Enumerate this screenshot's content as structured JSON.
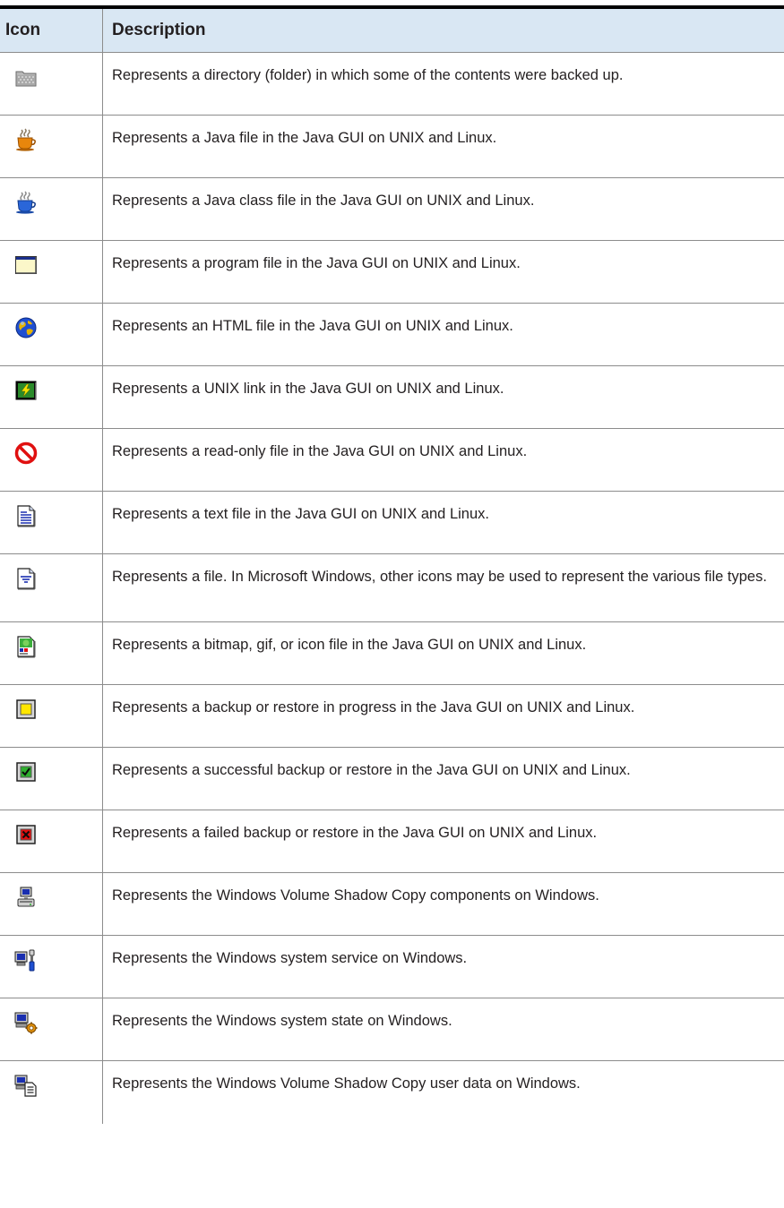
{
  "table": {
    "header": {
      "icon": "Icon",
      "description": "Description"
    },
    "rows": [
      {
        "icon": "partial-folder-icon",
        "description": "Represents a directory (folder) in which some of the contents were backed up."
      },
      {
        "icon": "java-file-icon",
        "description": "Represents a Java file in the Java GUI on UNIX and Linux."
      },
      {
        "icon": "java-class-file-icon",
        "description": "Represents a Java class file in the Java GUI on UNIX and Linux."
      },
      {
        "icon": "program-file-icon",
        "description": "Represents a program file in the Java GUI on UNIX and Linux."
      },
      {
        "icon": "html-file-globe-icon",
        "description": "Represents an HTML file in the Java GUI on UNIX and Linux."
      },
      {
        "icon": "unix-link-icon",
        "description": "Represents a UNIX link in the Java GUI on UNIX and Linux."
      },
      {
        "icon": "read-only-file-icon",
        "description": "Represents a read-only file in the Java GUI on UNIX and Linux."
      },
      {
        "icon": "text-file-icon",
        "description": "Represents a text file in the Java GUI on UNIX and Linux."
      },
      {
        "icon": "generic-file-icon",
        "description": "Represents a file. In Microsoft Windows, other icons may be used to represent the various file types."
      },
      {
        "icon": "image-file-icon",
        "description": "Represents a bitmap, gif, or icon file in the Java GUI on UNIX and Linux."
      },
      {
        "icon": "in-progress-icon",
        "description": "Represents a backup or restore in progress in the Java GUI on UNIX and Linux."
      },
      {
        "icon": "success-icon",
        "description": "Represents a successful backup or restore in the Java GUI on UNIX and Linux."
      },
      {
        "icon": "failed-icon",
        "description": "Represents a failed backup or restore in the Java GUI on UNIX and Linux."
      },
      {
        "icon": "vss-components-icon",
        "description": "Represents the Windows Volume Shadow Copy components on Windows."
      },
      {
        "icon": "system-service-icon",
        "description": "Represents the Windows system service on Windows."
      },
      {
        "icon": "system-state-icon",
        "description": "Represents the Windows system state on Windows."
      },
      {
        "icon": "vss-user-data-icon",
        "description": "Represents the Windows Volume Shadow Copy user data on Windows."
      }
    ]
  },
  "colors": {
    "header_background": "#d9e7f3",
    "rule": "#000000",
    "grid": "#8c8c8c",
    "text": "#231f20"
  }
}
